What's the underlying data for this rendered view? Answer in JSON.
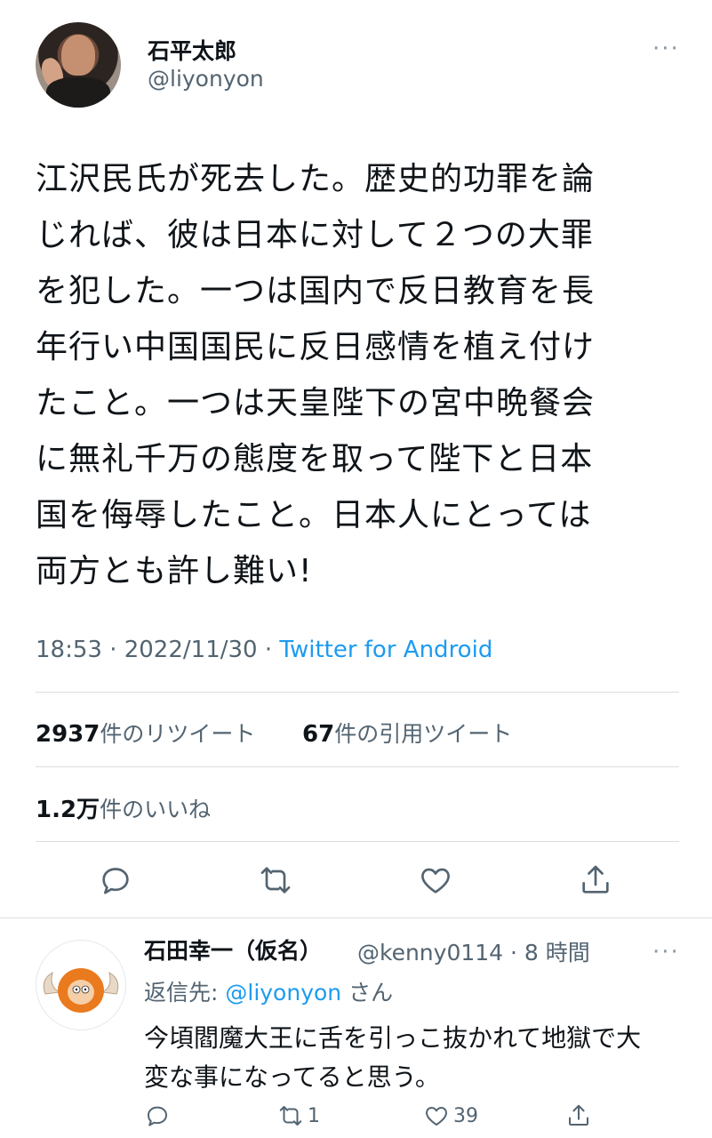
{
  "author": {
    "display_name": "石平太郎",
    "handle": "@liyonyon"
  },
  "more_label": "···",
  "tweet": {
    "text": "江沢民氏が死去した。歴史的功罪を論\nじれば、彼は日本に対して２つの大罪\nを犯した。一つは国内で反日教育を長\n年行い中国国民に反日感情を植え付け\nたこと。一つは天皇陛下の宮中晩餐会\nに無礼千万の態度を取って陛下と日本\n国を侮辱したこと。日本人にとっては\n両方とも許し難い!",
    "time": "18:53 · 2022/11/30 · ",
    "source": "Twitter for Android"
  },
  "stats": {
    "retweets_count": "2937",
    "retweets_label": "件のリツイート",
    "quotes_count": "67",
    "quotes_label": "件の引用ツイート",
    "likes_count": "1.2万",
    "likes_label": "件のいいね"
  },
  "actions": {
    "reply_icon": "reply-icon",
    "retweet_icon": "retweet-icon",
    "like_icon": "heart-icon",
    "share_icon": "share-icon"
  },
  "reply": {
    "display_name": "石田幸一（仮名）",
    "handle_time": "@kenny0114 · 8 時間",
    "replying_prefix": "返信先: ",
    "replying_mention": "@liyonyon",
    "replying_suffix": " さん",
    "text": "今頃閻魔大王に舌を引っこ抜かれて地獄で大\n変な事になってると思う。",
    "retweet_count": "1",
    "like_count": "39"
  },
  "colors": {
    "accent": "#1d9bf0",
    "secondary_text": "#536471",
    "primary_text": "#0f1419",
    "divider": "#d9dee2"
  }
}
